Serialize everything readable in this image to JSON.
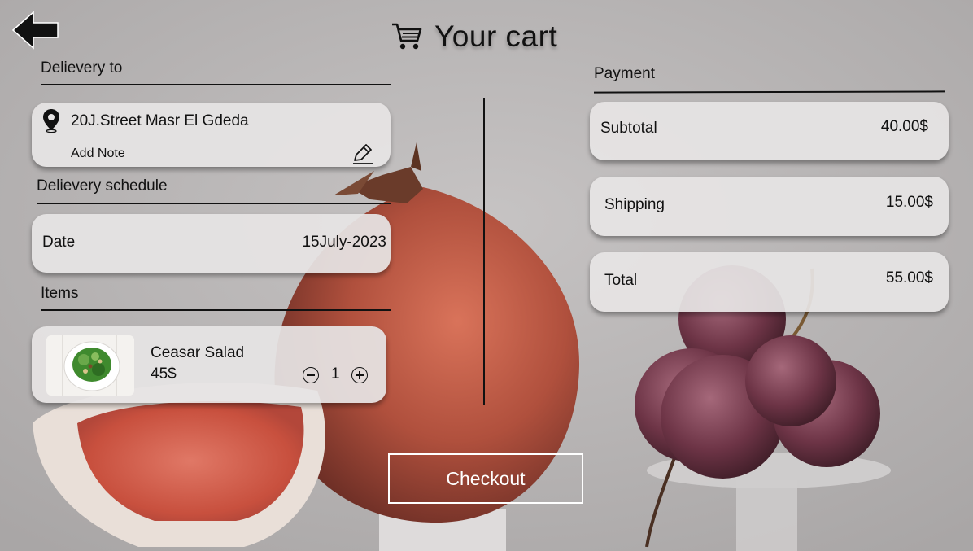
{
  "header": {
    "back_icon": "arrow-left-icon",
    "cart_icon": "shopping-cart-icon",
    "title": "Your cart"
  },
  "delivery": {
    "section_label": "Delievery to",
    "pin_icon": "location-pin-icon",
    "address": "20J.Street Masr El Gdeda",
    "note_label": "Add Note",
    "edit_icon": "pencil-icon"
  },
  "schedule": {
    "section_label": "Delievery schedule",
    "date_label": "Date",
    "date_value": "15July-2023"
  },
  "items": {
    "section_label": "Items",
    "list": [
      {
        "name": "Ceasar Salad",
        "price": "45$",
        "quantity": "1",
        "image": "salad-bowl-image"
      }
    ]
  },
  "payment": {
    "section_label": "Payment",
    "subtotal_label": "Subtotal",
    "subtotal_value": "40.00$",
    "shipping_label": "Shipping",
    "shipping_value": "15.00$",
    "total_label": "Total",
    "total_value": "55.00$"
  },
  "checkout": {
    "label": "Checkout"
  },
  "colors": {
    "background": "#b6b3b3",
    "card": "#e6e4e4",
    "text": "#111111",
    "checkout_border": "#ffffff"
  }
}
